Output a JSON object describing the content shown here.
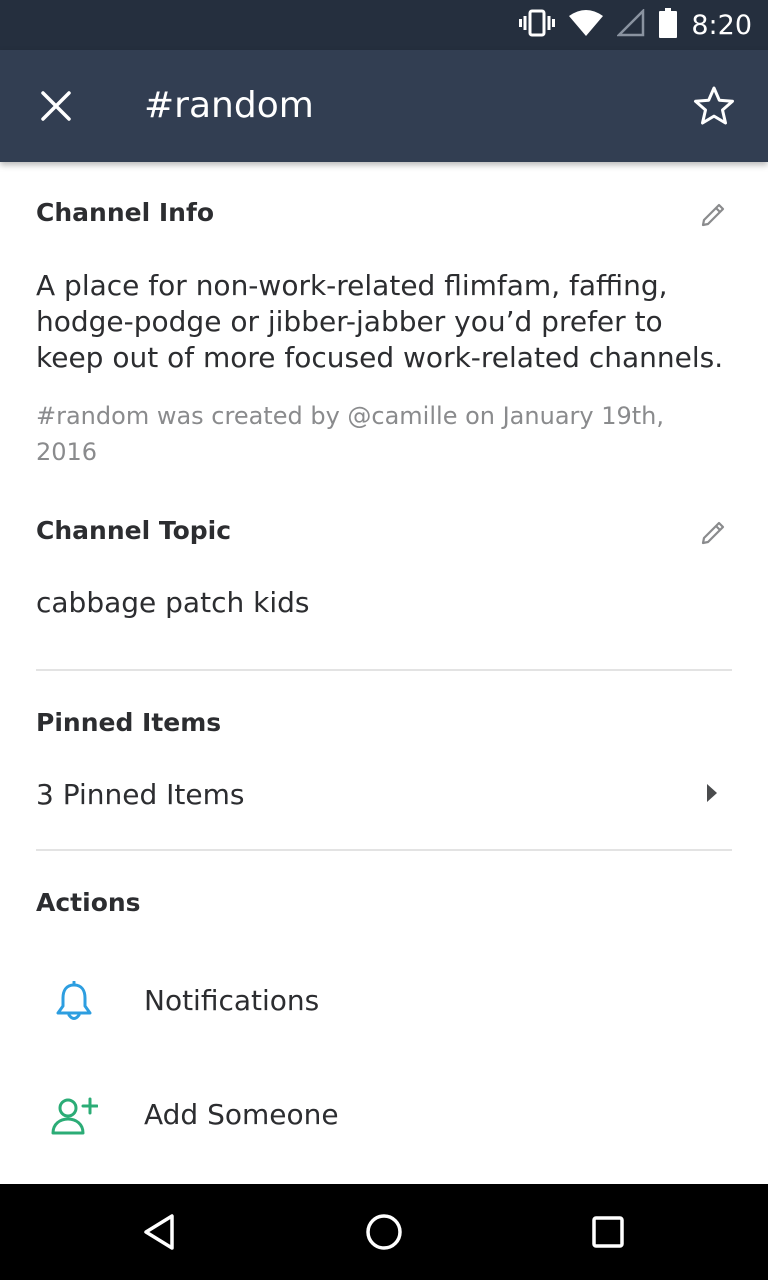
{
  "status_bar": {
    "time": "8:20",
    "icons": [
      "vibrate-icon",
      "wifi-icon",
      "signal-icon",
      "battery-icon"
    ]
  },
  "app_bar": {
    "title": "#random",
    "close_icon": "close-icon",
    "star_icon": "star-outline-icon"
  },
  "channel_info": {
    "header": "Channel Info",
    "description": "A place for non-work-related flimfam, faffing, hodge-podge or jibber-jabber you’d prefer to keep out of more focused work-related channels.",
    "created": "#random was created by @camille on January 19th, 2016",
    "edit_icon": "pencil-icon"
  },
  "channel_topic": {
    "header": "Channel Topic",
    "value": "cabbage patch kids",
    "edit_icon": "pencil-icon"
  },
  "pinned": {
    "header": "Pinned Items",
    "label": "3 Pinned Items",
    "chevron_icon": "chevron-right-icon"
  },
  "actions": {
    "header": "Actions",
    "items": [
      {
        "label": "Notifications",
        "icon": "bell-icon",
        "color": "#2d9ee0"
      },
      {
        "label": "Add Someone",
        "icon": "add-user-icon",
        "color": "#2bac76"
      }
    ]
  },
  "nav_bar": {
    "icons": [
      "back-icon",
      "home-icon",
      "recents-icon"
    ]
  }
}
